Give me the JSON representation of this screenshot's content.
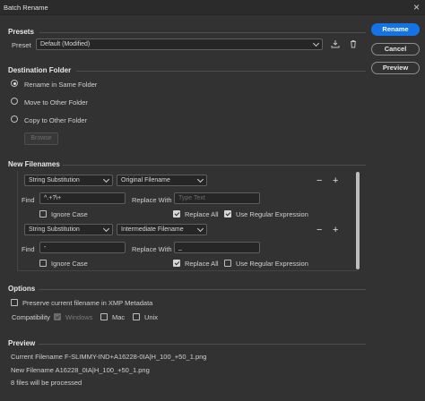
{
  "window": {
    "title": "Batch Rename",
    "close_glyph": "×"
  },
  "buttons": {
    "rename": "Rename",
    "cancel": "Cancel",
    "preview": "Preview",
    "browse": "Browse"
  },
  "presets": {
    "section": "Presets",
    "label": "Preset",
    "value": "Default (Modified)"
  },
  "destination": {
    "section": "Destination Folder",
    "options": [
      "Rename in Same Folder",
      "Move to Other Folder",
      "Copy to Other Folder"
    ],
    "selected_index": 0
  },
  "new_filenames": {
    "section": "New Filenames",
    "rules": [
      {
        "type": "String Substitution",
        "source": "Original Filename",
        "find_label": "Find",
        "find_value": "^.+?\\+",
        "replace_label": "Replace With",
        "replace_value": "",
        "replace_placeholder": "Type Text",
        "ignore_case_label": "Ignore Case",
        "ignore_case": false,
        "replace_all_label": "Replace All",
        "replace_all": true,
        "regex_label": "Use Regular Expression",
        "regex": true
      },
      {
        "type": "String Substitution",
        "source": "Intermediate Filename",
        "find_label": "Find",
        "find_value": "-",
        "replace_label": "Replace With",
        "replace_value": "_",
        "replace_placeholder": "",
        "ignore_case_label": "Ignore Case",
        "ignore_case": false,
        "replace_all_label": "Replace All",
        "replace_all": true,
        "regex_label": "Use Regular Expression",
        "regex": false
      }
    ],
    "minus": "−",
    "plus": "+"
  },
  "options": {
    "section": "Options",
    "preserve_label": "Preserve current filename in XMP Metadata",
    "preserve": false,
    "compatibility_label": "Compatibility",
    "windows_label": "Windows",
    "mac_label": "Mac",
    "unix_label": "Unix"
  },
  "preview": {
    "section": "Preview",
    "current": "Current Filename F-SLIMMY-IND+A16228-0IA|H_100_+50_1.png",
    "new": "New Filename A16228_0IA|H_100_+50_1.png",
    "count": "8 files will be processed"
  }
}
